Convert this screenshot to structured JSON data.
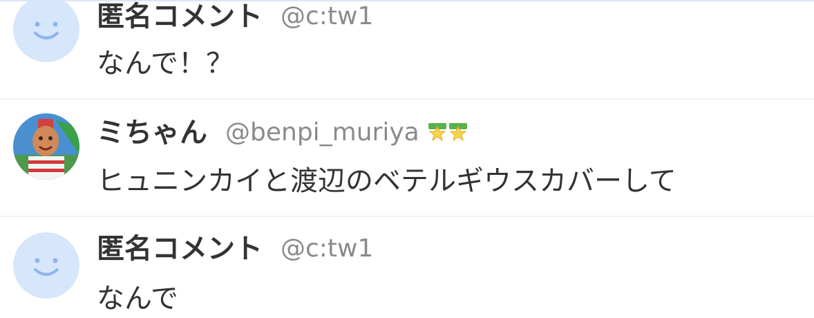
{
  "comments": [
    {
      "name": "匿名コメント",
      "handle": "@c:tw1",
      "text": "なんで！？",
      "avatar": "default-smiley-avatar"
    },
    {
      "name": "ミちゃん",
      "handle": "@benpi_muriya",
      "text": "ヒュニンカイと渡辺のベテルギウスカバーして",
      "avatar": "user-photo-avatar",
      "badge_icons": [
        "star-badge-icon",
        "star-badge-icon"
      ]
    },
    {
      "name": "匿名コメント",
      "handle": "@c:tw1",
      "text": "なんで",
      "avatar": "default-smiley-avatar"
    }
  ],
  "colors": {
    "name": "#333333",
    "handle": "#8a8a8a",
    "default_avatar_bg": "#d6e6fb",
    "default_avatar_face": "#8db4ee",
    "badge_star": "#f6d64a",
    "badge_leaf": "#59b24a"
  }
}
